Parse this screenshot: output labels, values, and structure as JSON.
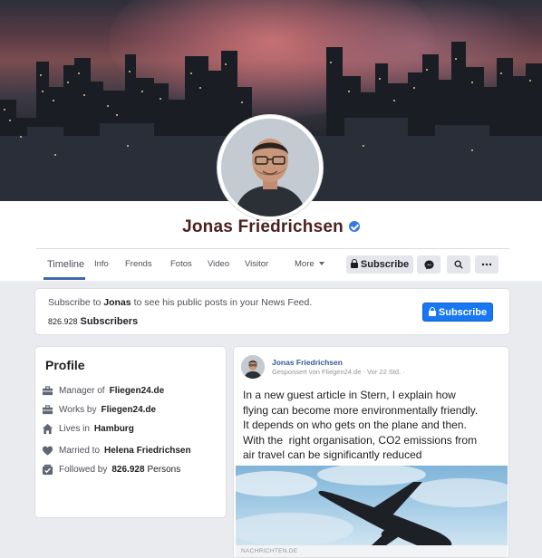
{
  "profile_header": {
    "name": "Jonas Friedrichsen",
    "verified": true
  },
  "nav": {
    "tabs": [
      "Timeline",
      "Info",
      "Frends",
      "Fotos",
      "Video",
      "Visitor"
    ],
    "more_label": "More",
    "subscribe_label": "Subscribe",
    "icons": [
      "messenger-icon",
      "search-icon",
      "more-dots-icon"
    ]
  },
  "subscribe_card": {
    "text_before": "Subscribe to ",
    "name": "Jonas",
    "text_after": " to see his public posts in your News Feed.",
    "count": "826.928",
    "count_label": "Subscribers",
    "button_label": "Subscribe"
  },
  "profile_card": {
    "title": "Profile",
    "rows": [
      {
        "icon": "briefcase-icon",
        "label": "Manager of",
        "value": "Fliegen24.de",
        "rest": ""
      },
      {
        "icon": "briefcase-icon",
        "label": "Works by",
        "value": "Fliegen24.de",
        "rest": ""
      },
      {
        "icon": "home-icon",
        "label": "Lives in",
        "value": "Hamburg",
        "rest": ""
      },
      {
        "icon": "heart-icon",
        "label": "Married to",
        "value": "Helena Friedrichsen",
        "rest": ""
      },
      {
        "icon": "followers-icon",
        "label": "Followed by",
        "value": "826.928",
        "rest": "Persons"
      }
    ]
  },
  "post": {
    "author": "Jonas Friedrichsen",
    "meta": "Gesponsert von Fliegen24.de · Vor 22 Std. ·",
    "body_lines": [
      "In a new guest article in Stern, I explain how",
      "flying can become more environmentally friendly.",
      "It depends on who gets on the plane and then.",
      "With the  right organisation, CO2 emissions from",
      "air travel can be significantly reduced"
    ],
    "link_source": "NACHRICHTEN.DE"
  },
  "colors": {
    "accent_blue": "#1877f2",
    "name_color": "#4b1f1f",
    "link_blue": "#385898"
  }
}
